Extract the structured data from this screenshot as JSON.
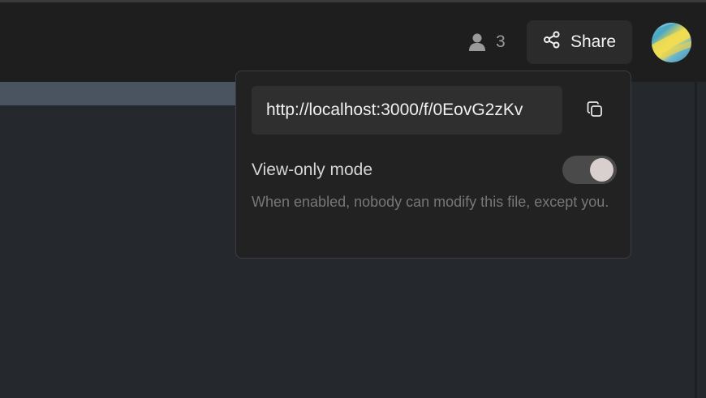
{
  "header": {
    "collaborators_count": "3",
    "share_label": "Share",
    "icons": {
      "collaborators": "user-icon",
      "share": "share-icon",
      "avatar": "user-avatar"
    }
  },
  "share_popover": {
    "url": "http://localhost:3000/f/0EovG2zKv",
    "copy_icon": "copy-icon",
    "view_only_label": "View-only mode",
    "view_only_enabled": true,
    "view_only_description": "When enabled, nobody can modify this file, except you."
  },
  "colors": {
    "topbar": "#1e1e1e",
    "editor": "#25292e",
    "popover": "#222222",
    "accent_strip": "#4a5461"
  }
}
